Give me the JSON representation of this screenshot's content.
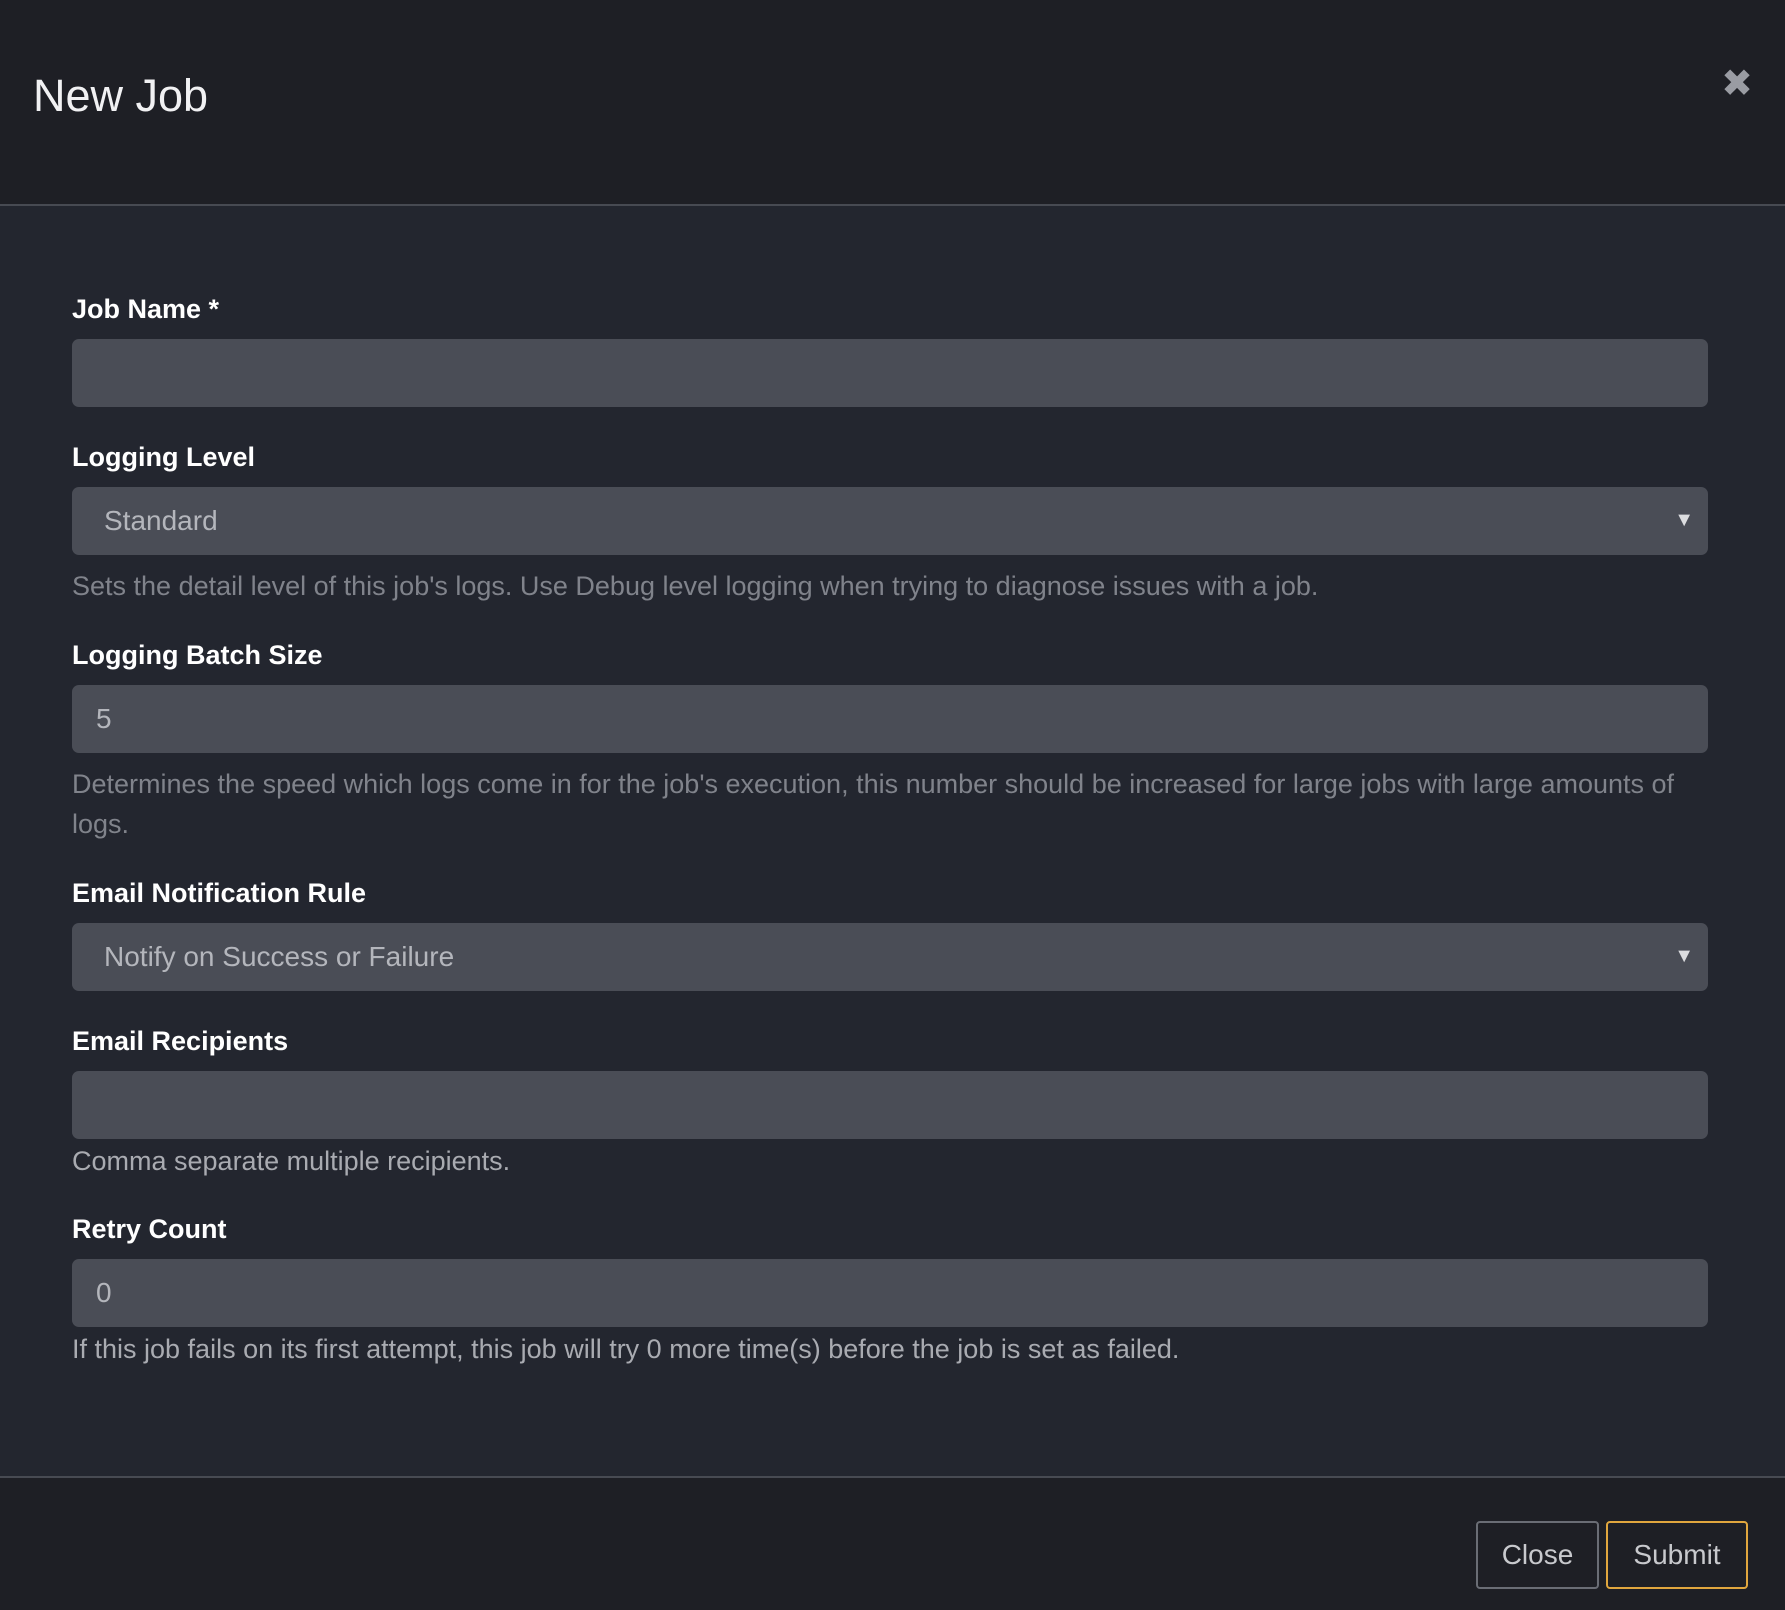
{
  "modal": {
    "title": "New Job",
    "close_icon": "close-icon"
  },
  "fields": {
    "job_name": {
      "label": "Job Name *",
      "value": ""
    },
    "logging_level": {
      "label": "Logging Level",
      "selected": "Standard",
      "help": "Sets the detail level of this job's logs. Use Debug level logging when trying to diagnose issues with a job."
    },
    "logging_batch_size": {
      "label": "Logging Batch Size",
      "value": "5",
      "help": "Determines the speed which logs come in for the job's execution, this number should be increased for large jobs with large amounts of logs."
    },
    "email_notification_rule": {
      "label": "Email Notification Rule",
      "selected": "Notify on Success or Failure"
    },
    "email_recipients": {
      "label": "Email Recipients",
      "value": "",
      "help": "Comma separate multiple recipients."
    },
    "retry_count": {
      "label": "Retry Count",
      "value": "0",
      "help": "If this job fails on its first attempt, this job will try 0 more time(s) before the job is set as failed."
    }
  },
  "footer": {
    "close_label": "Close",
    "submit_label": "Submit"
  },
  "colors": {
    "header_bg": "#1e1f25",
    "body_bg": "#23262f",
    "input_bg": "#4a4d56",
    "submit_border": "#e0a63e"
  }
}
